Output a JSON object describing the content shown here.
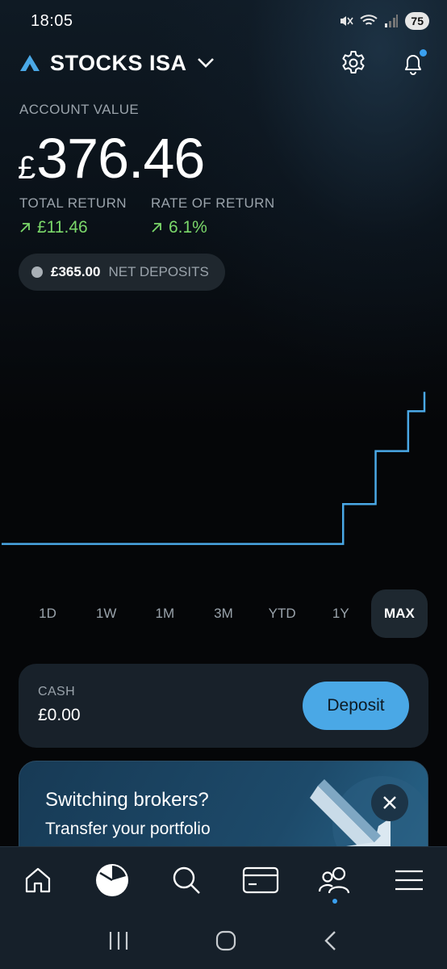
{
  "status_bar": {
    "time": "18:05",
    "battery": "75"
  },
  "header": {
    "account_title": "STOCKS ISA"
  },
  "summary": {
    "account_label": "ACCOUNT VALUE",
    "currency_symbol": "£",
    "account_value": "376.46",
    "total_return_label": "TOTAL RETURN",
    "total_return_value": "£11.46",
    "rate_of_return_label": "RATE OF RETURN",
    "rate_of_return_value": "6.1%",
    "net_deposits_amount": "£365.00",
    "net_deposits_label": "NET DEPOSITS"
  },
  "chart_data": {
    "type": "line",
    "series": [
      {
        "values": [
          365,
          365,
          365,
          365,
          365,
          365,
          365,
          365,
          365,
          365,
          365,
          365,
          365,
          365,
          365,
          365,
          365,
          365,
          365,
          365,
          365,
          368,
          368,
          372,
          372,
          375,
          376.46
        ]
      }
    ],
    "ylim": [
      364,
      378
    ],
    "grid": false,
    "line_color": "#4aa8e6"
  },
  "timeframes": {
    "items": [
      "1D",
      "1W",
      "1M",
      "3M",
      "YTD",
      "1Y",
      "MAX"
    ],
    "active": "MAX"
  },
  "cash": {
    "label": "CASH",
    "value": "£0.00",
    "button": "Deposit"
  },
  "promo": {
    "title": "Switching brokers?",
    "subtitle": "Transfer your portfolio"
  },
  "bottom_nav": [
    "home-icon",
    "portfolio-pie-icon",
    "search-icon",
    "card-icon",
    "community-icon",
    "menu-icon"
  ],
  "colors": {
    "accent": "#4aa8e6",
    "positive": "#7bd86a",
    "background": "#050608",
    "card": "#18212a"
  }
}
